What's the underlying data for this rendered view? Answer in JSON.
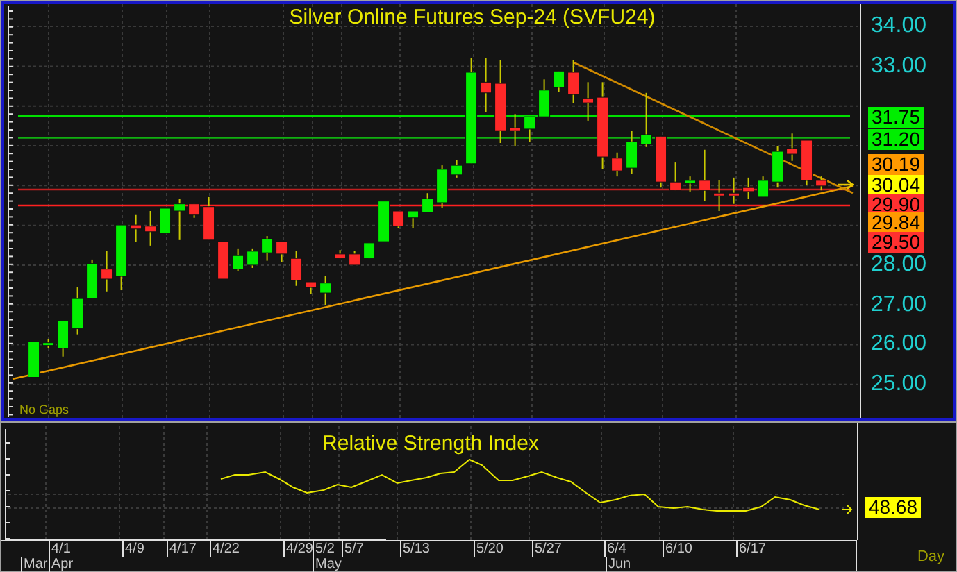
{
  "title": "Silver Online Futures Sep-24 (SVFU24)",
  "price_tags": [
    {
      "text": "31.75",
      "color": "#00ee00"
    },
    {
      "text": "31.20",
      "color": "#00ee00"
    },
    {
      "text": "30.19",
      "color": "#ff9900"
    },
    {
      "text": "30.04",
      "color": "#ffff00"
    },
    {
      "text": "29.90",
      "color": "#ff3030"
    },
    {
      "text": "29.84",
      "color": "#ff9900"
    },
    {
      "text": "29.50",
      "color": "#ff3030"
    }
  ],
  "chart_data": {
    "type": "candlestick",
    "categories": [
      null,
      null,
      null,
      null,
      null,
      null,
      null,
      null,
      null,
      null,
      null,
      null,
      null,
      null,
      null,
      null,
      null,
      null,
      null,
      null,
      null,
      null,
      null,
      null,
      null,
      null,
      null,
      null,
      null,
      null,
      null,
      null,
      null,
      null,
      null,
      null,
      null,
      null,
      null,
      null,
      null,
      null,
      null,
      null,
      null,
      null,
      null,
      null,
      null,
      null,
      null,
      null,
      null,
      null,
      null
    ],
    "ylim": [
      24.16,
      34.56
    ],
    "grid": true,
    "ref_lines": [
      {
        "axis": "y",
        "value": 31.75,
        "color": "#00e000"
      },
      {
        "axis": "y",
        "value": 31.2,
        "color": "#10b010"
      },
      {
        "axis": "y",
        "value": 29.9,
        "color": "#c02020"
      },
      {
        "axis": "y",
        "value": 29.5,
        "color": "#ff2020"
      }
    ],
    "yticks": [
      {
        "value": 34,
        "label": "34.00"
      },
      {
        "value": 33,
        "label": "33.00"
      },
      {
        "value": 28,
        "label": "28.00"
      },
      {
        "value": 27,
        "label": "27.00"
      },
      {
        "value": 26,
        "label": "26.00"
      },
      {
        "value": 25,
        "label": "25.00"
      }
    ],
    "ohlc": [
      [
        25.18,
        26.08,
        25.18,
        26.08
      ],
      [
        25.98,
        26.15,
        25.91,
        26.05
      ],
      [
        25.91,
        26.61,
        25.7,
        26.61
      ],
      [
        26.4,
        27.44,
        26.26,
        27.16
      ],
      [
        27.16,
        28.14,
        27.16,
        28.04
      ],
      [
        27.9,
        28.35,
        27.34,
        27.65
      ],
      [
        27.72,
        29.01,
        27.37,
        29.01
      ],
      [
        29.01,
        29.26,
        28.59,
        28.91
      ],
      [
        28.98,
        29.36,
        28.49,
        28.84
      ],
      [
        28.8,
        29.43,
        28.8,
        29.43
      ],
      [
        29.36,
        29.67,
        28.63,
        29.54
      ],
      [
        29.54,
        29.54,
        29.19,
        29.26
      ],
      [
        29.47,
        29.71,
        28.63,
        28.63
      ],
      [
        28.59,
        28.59,
        27.65,
        27.65
      ],
      [
        27.9,
        28.42,
        27.86,
        28.24
      ],
      [
        28.0,
        28.42,
        27.93,
        28.35
      ],
      [
        28.31,
        28.73,
        28.11,
        28.66
      ],
      [
        28.59,
        28.59,
        28.07,
        28.28
      ],
      [
        28.17,
        28.35,
        27.48,
        27.62
      ],
      [
        27.58,
        27.58,
        27.27,
        27.44
      ],
      [
        27.3,
        27.72,
        26.99,
        27.55
      ],
      [
        28.28,
        28.38,
        28.17,
        28.17
      ],
      [
        28.28,
        28.35,
        28.0,
        28.0
      ],
      [
        28.17,
        28.56,
        28.17,
        28.56
      ],
      [
        28.59,
        29.61,
        28.59,
        29.61
      ],
      [
        29.36,
        29.36,
        28.94,
        28.98
      ],
      [
        29.19,
        29.36,
        28.94,
        29.36
      ],
      [
        29.33,
        29.81,
        29.33,
        29.67
      ],
      [
        29.57,
        30.51,
        29.43,
        30.41
      ],
      [
        30.27,
        30.65,
        30.2,
        30.51
      ],
      [
        30.55,
        33.2,
        30.55,
        32.85
      ],
      [
        32.6,
        33.2,
        31.84,
        32.33
      ],
      [
        32.57,
        33.16,
        31.07,
        31.38
      ],
      [
        31.45,
        31.8,
        31.0,
        31.38
      ],
      [
        31.42,
        31.73,
        31.1,
        31.73
      ],
      [
        31.73,
        32.67,
        31.73,
        32.4
      ],
      [
        32.47,
        32.88,
        32.36,
        32.88
      ],
      [
        32.85,
        33.16,
        32.08,
        32.29
      ],
      [
        32.19,
        32.6,
        31.63,
        32.08
      ],
      [
        32.22,
        32.6,
        30.41,
        30.72
      ],
      [
        30.69,
        30.83,
        30.23,
        30.37
      ],
      [
        30.44,
        31.38,
        30.3,
        31.1
      ],
      [
        31.04,
        32.33,
        30.97,
        31.28
      ],
      [
        31.24,
        31.24,
        29.95,
        30.09
      ],
      [
        30.09,
        30.58,
        29.88,
        29.88
      ],
      [
        30.06,
        30.23,
        29.85,
        30.13
      ],
      [
        30.13,
        30.9,
        29.61,
        29.88
      ],
      [
        29.81,
        30.13,
        29.36,
        29.74
      ],
      [
        29.81,
        30.2,
        29.54,
        29.74
      ],
      [
        29.95,
        30.2,
        29.67,
        29.85
      ],
      [
        29.71,
        30.23,
        29.71,
        30.13
      ],
      [
        30.09,
        31.0,
        29.95,
        30.86
      ],
      [
        30.93,
        31.31,
        30.62,
        30.79
      ],
      [
        31.14,
        31.14,
        30.02,
        30.13
      ],
      [
        30.13,
        30.23,
        29.88,
        29.99
      ]
    ]
  },
  "note": "No Gaps",
  "indicator": {
    "title": "Relative Strength Index",
    "value_tag": "48.68"
  },
  "date_axis": {
    "days": [
      "4/1",
      "4/9",
      "4/17",
      "4/22",
      "4/29",
      "5/2",
      "5/7",
      "5/13",
      "5/20",
      "5/27",
      "6/4",
      "6/10",
      "6/17"
    ],
    "months": [
      "Mar",
      "Apr",
      "May",
      "Jun"
    ]
  },
  "period": "Day"
}
